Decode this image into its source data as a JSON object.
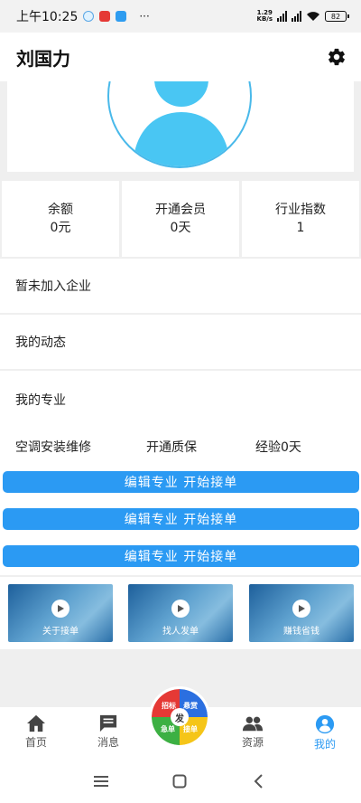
{
  "status_bar": {
    "time": "上午10:25",
    "more": "···",
    "net_speed_value": "1.29",
    "net_speed_unit": "KB/s",
    "battery": "82"
  },
  "header": {
    "title": "刘国力",
    "settings_icon": "gear-icon"
  },
  "stats": [
    {
      "label": "余额",
      "value": "0元"
    },
    {
      "label": "开通会员",
      "value": "0天"
    },
    {
      "label": "行业指数",
      "value": "1"
    }
  ],
  "rows": {
    "company": "暂未加入企业",
    "feed": "我的动态"
  },
  "specialty": {
    "title": "我的专业",
    "name": "空调安装维修",
    "quality": "开通质保",
    "experience": "经验0天",
    "buttons": [
      "编辑专业  开始接单",
      "编辑专业  开始接单",
      "编辑专业  开始接单"
    ]
  },
  "videos": [
    {
      "label": "关于接单"
    },
    {
      "label": "找人发单"
    },
    {
      "label": "赚钱省钱"
    }
  ],
  "bottom_nav": {
    "items": [
      {
        "label": "首页",
        "icon": "home-icon"
      },
      {
        "label": "消息",
        "icon": "message-icon"
      },
      {
        "label": "资源",
        "icon": "people-icon"
      },
      {
        "label": "我的",
        "icon": "account-icon"
      }
    ],
    "fab": {
      "center": "发",
      "q1": "招标",
      "q2": "悬赏",
      "q3": "急单",
      "q4": "接单"
    }
  },
  "colors": {
    "accent": "#2b9af3",
    "avatar": "#49c6f3"
  }
}
